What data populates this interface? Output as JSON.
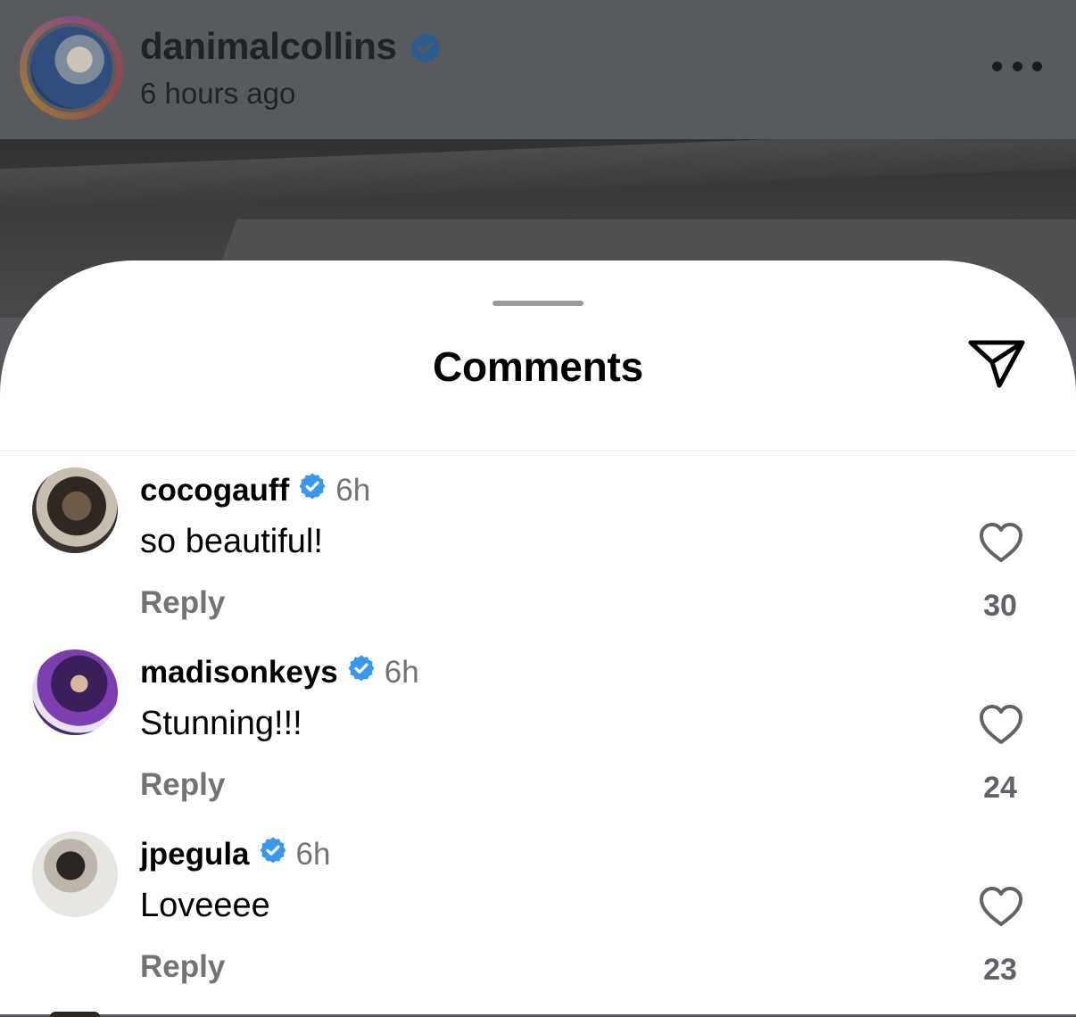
{
  "post": {
    "username": "danimalcollins",
    "time": "6 hours ago"
  },
  "sheet": {
    "title": "Comments"
  },
  "icons": {
    "verified_color": "#3897f0",
    "more": "more-options-icon",
    "send": "send-icon",
    "like": "heart-outline-icon"
  },
  "comments": [
    {
      "username": "cocogauff",
      "time": "6h",
      "text": "so beautiful!",
      "reply_label": "Reply",
      "likes": "30"
    },
    {
      "username": "madisonkeys",
      "time": "6h",
      "text": "Stunning!!!",
      "reply_label": "Reply",
      "likes": "24"
    },
    {
      "username": "jpegula",
      "time": "6h",
      "text": "Loveeee",
      "reply_label": "Reply",
      "likes": "23"
    }
  ]
}
